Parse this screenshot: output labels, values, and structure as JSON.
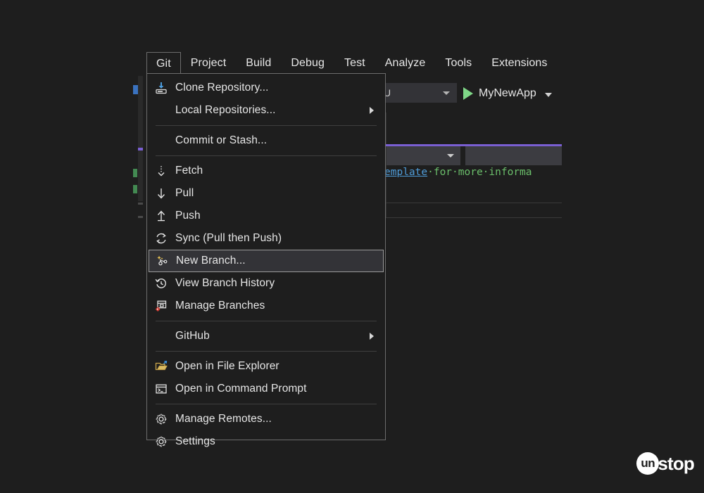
{
  "app": {
    "background_color": "#1e1e1e",
    "accent_purple": "#7a5fd3"
  },
  "menubar": {
    "items": [
      {
        "label": "Git",
        "active": true
      },
      {
        "label": "Project",
        "active": false
      },
      {
        "label": "Build",
        "active": false
      },
      {
        "label": "Debug",
        "active": false
      },
      {
        "label": "Test",
        "active": false
      },
      {
        "label": "Analyze",
        "active": false
      },
      {
        "label": "Tools",
        "active": false
      },
      {
        "label": "Extensions",
        "active": false
      }
    ]
  },
  "toolbar": {
    "platform_value": "U",
    "run_label": "MyNewApp",
    "run_icon": "play-triangle-icon",
    "dropdown_icon": "chevron-down-icon"
  },
  "editor": {
    "code_link": "emplate",
    "code_rest": "·for·more·informa",
    "nav_dropdown_icon": "chevron-down-icon"
  },
  "git_menu": {
    "items": [
      {
        "label": "Clone Repository...",
        "icon": "clone-repository-icon",
        "submenu": false,
        "selected": false
      },
      {
        "label": "Local Repositories...",
        "icon": "none",
        "submenu": true,
        "selected": false
      },
      {
        "separator_after": true
      },
      {
        "label": "Commit or Stash...",
        "icon": "none",
        "submenu": false,
        "selected": false
      },
      {
        "separator_after": true
      },
      {
        "label": "Fetch",
        "icon": "fetch-icon",
        "submenu": false,
        "selected": false
      },
      {
        "label": "Pull",
        "icon": "pull-down-arrow-icon",
        "submenu": false,
        "selected": false
      },
      {
        "label": "Push",
        "icon": "push-up-arrow-icon",
        "submenu": false,
        "selected": false
      },
      {
        "label": "Sync (Pull then Push)",
        "icon": "sync-refresh-icon",
        "submenu": false,
        "selected": false
      },
      {
        "label": "New Branch...",
        "icon": "new-branch-icon",
        "submenu": false,
        "selected": true
      },
      {
        "label": "View Branch History",
        "icon": "history-clock-icon",
        "submenu": false,
        "selected": false
      },
      {
        "label": "Manage Branches",
        "icon": "manage-branches-icon",
        "submenu": false,
        "selected": false
      },
      {
        "separator_after": true
      },
      {
        "label": "GitHub",
        "icon": "none",
        "submenu": true,
        "selected": false
      },
      {
        "separator_after": true
      },
      {
        "label": "Open in File Explorer",
        "icon": "folder-open-icon",
        "submenu": false,
        "selected": false
      },
      {
        "label": "Open in Command Prompt",
        "icon": "command-prompt-icon",
        "submenu": false,
        "selected": false
      },
      {
        "separator_after": true
      },
      {
        "label": "Manage Remotes...",
        "icon": "gear-icon",
        "submenu": false,
        "selected": false
      },
      {
        "label": "Settings",
        "icon": "gear-icon",
        "submenu": false,
        "selected": false
      }
    ]
  },
  "watermark": {
    "mark": "un",
    "word": "stop"
  }
}
